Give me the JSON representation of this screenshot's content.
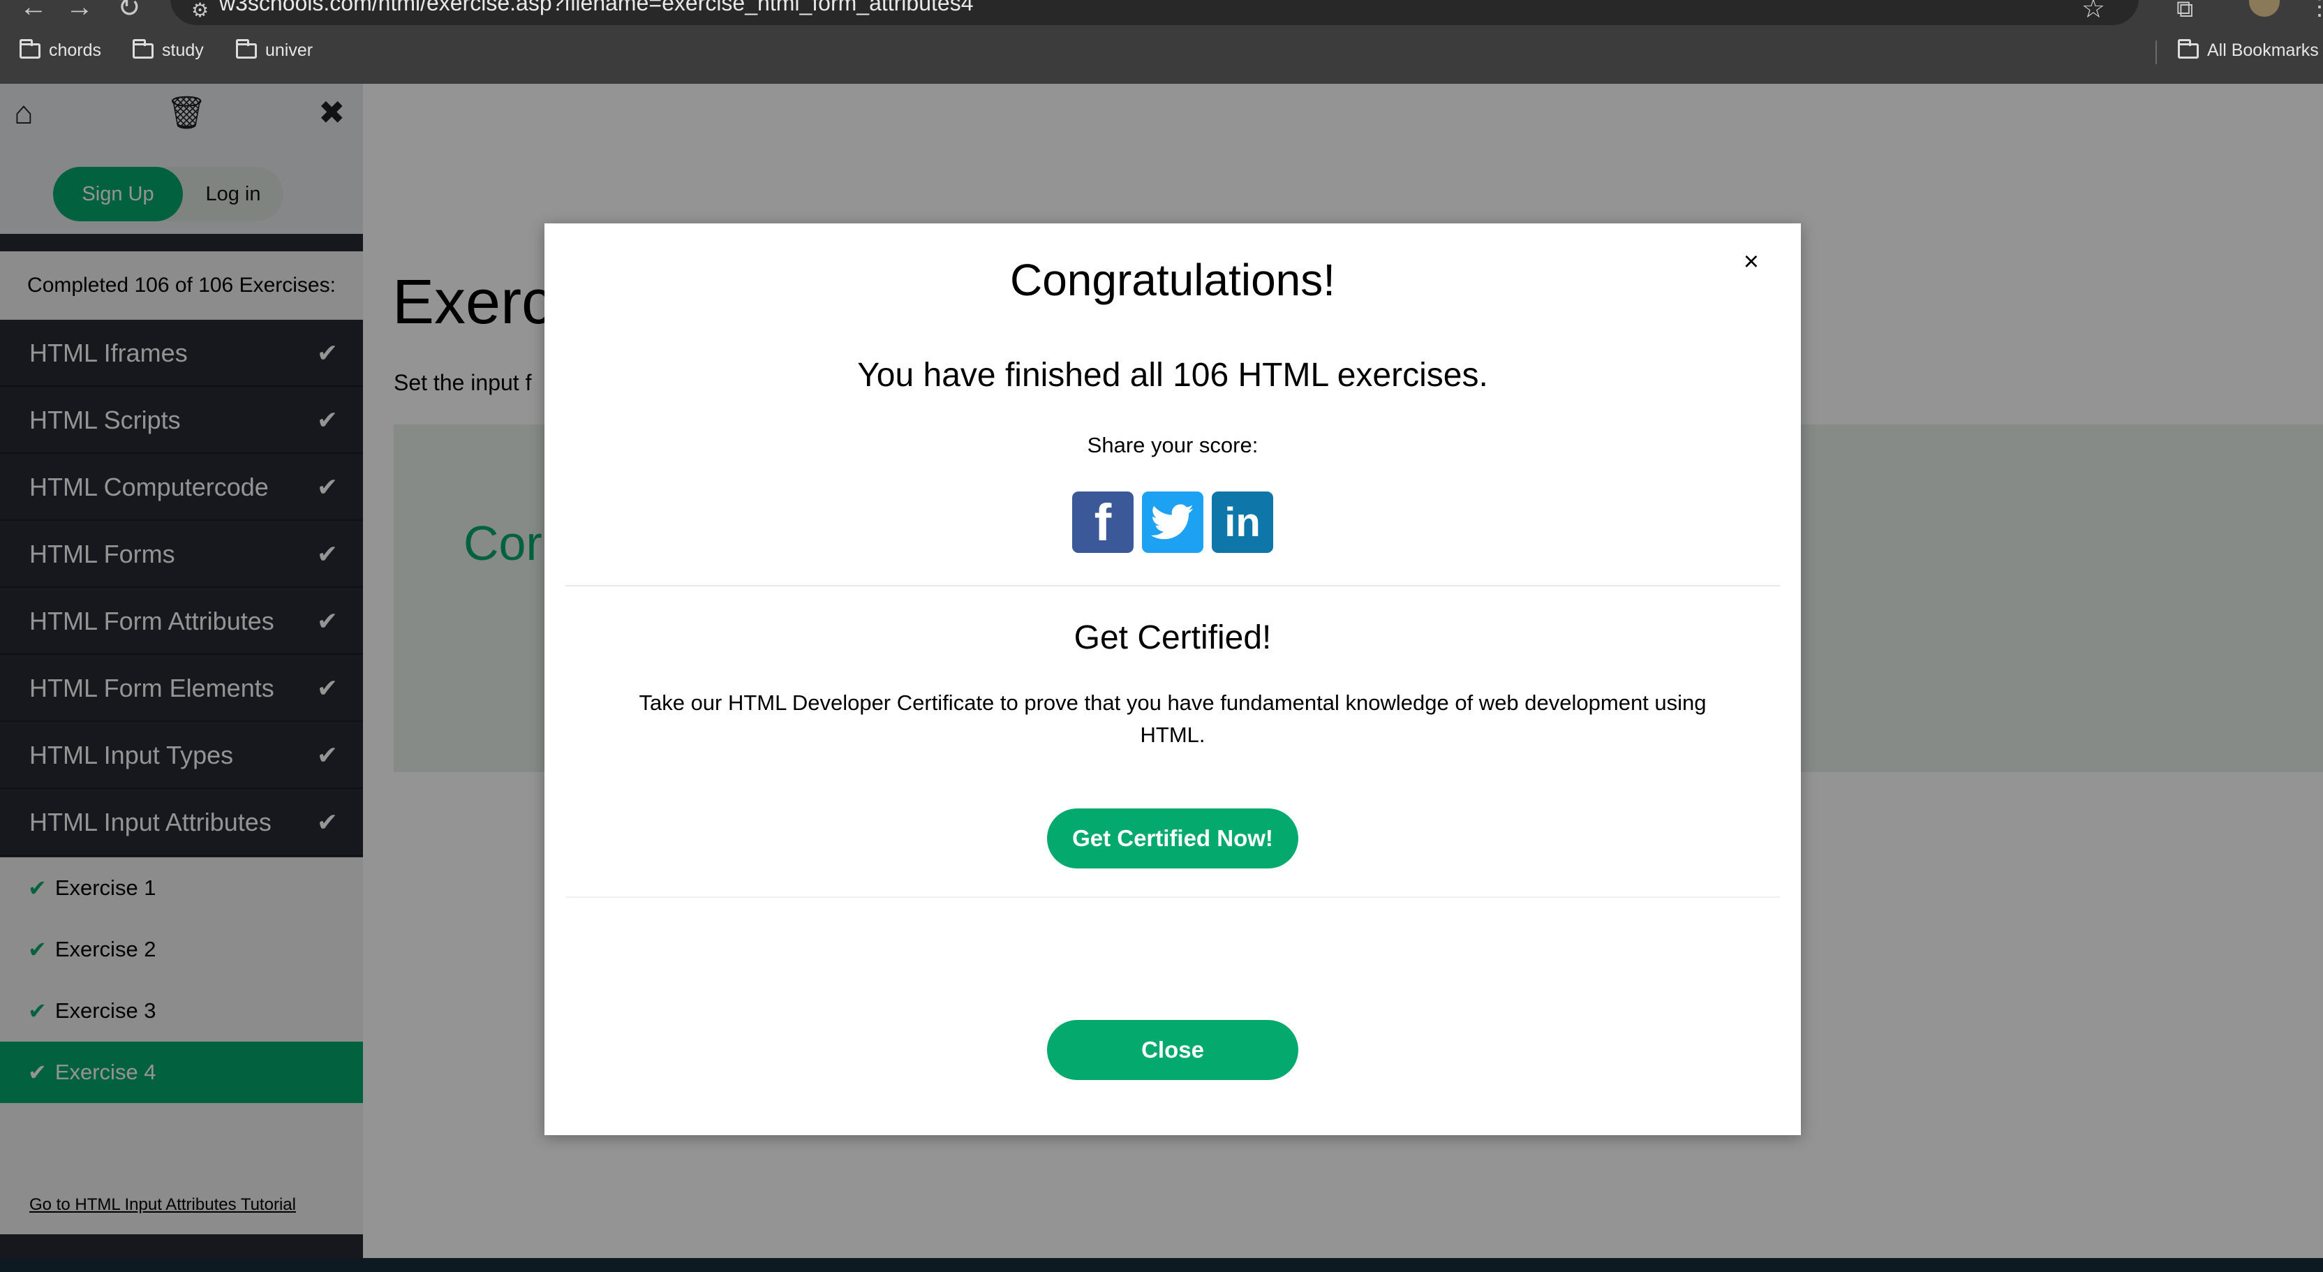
{
  "browser": {
    "url": "w3schools.com/html/exercise.asp?filename=exercise_html_form_attributes4",
    "bookmarks": [
      "chords",
      "study",
      "univer"
    ],
    "all_bookmarks_label": "All Bookmarks"
  },
  "sidebar": {
    "signup_label": "Sign Up",
    "login_label": "Log in",
    "completed_text": "Completed 106 of 106 Exercises:",
    "topics": [
      {
        "label": "HTML Iframes"
      },
      {
        "label": "HTML Scripts"
      },
      {
        "label": "HTML Computercode"
      },
      {
        "label": "HTML Forms"
      },
      {
        "label": "HTML Form Attributes"
      },
      {
        "label": "HTML Form Elements"
      },
      {
        "label": "HTML Input Types"
      },
      {
        "label": "HTML Input Attributes"
      }
    ],
    "exercises": [
      {
        "label": "Exercise 1"
      },
      {
        "label": "Exercise 2"
      },
      {
        "label": "Exercise 3"
      },
      {
        "label": "Exercise 4"
      }
    ],
    "tutorial_link": "Go to HTML Input Attributes Tutorial"
  },
  "main": {
    "title": "Exerc",
    "description": "Set the input f",
    "correct_text": "Cor"
  },
  "modal": {
    "close_x": "×",
    "title": "Congratulations!",
    "subtitle": "You have finished all 106 HTML exercises.",
    "share_label": "Share your score:",
    "cert_title": "Get Certified!",
    "cert_text": "Take our HTML Developer Certificate to prove that you have fundamental knowledge of web development using HTML.",
    "cert_button": "Get Certified Now!",
    "close_button": "Close"
  },
  "colors": {
    "accent": "#04aa6d",
    "sidebar_bg": "#282a35",
    "facebook": "#3b5998",
    "twitter": "#1da1f2",
    "linkedin": "#0e76a8"
  }
}
